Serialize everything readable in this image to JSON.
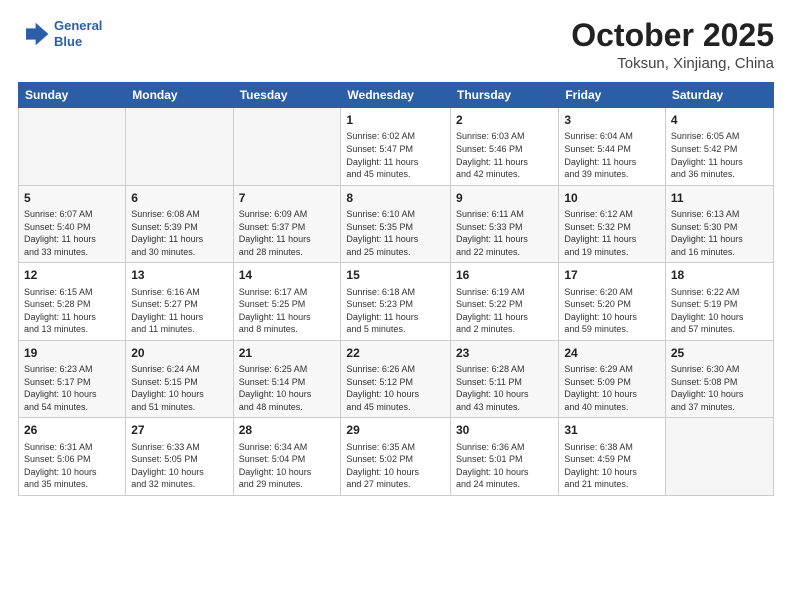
{
  "header": {
    "logo_line1": "General",
    "logo_line2": "Blue",
    "month": "October 2025",
    "location": "Toksun, Xinjiang, China"
  },
  "weekdays": [
    "Sunday",
    "Monday",
    "Tuesday",
    "Wednesday",
    "Thursday",
    "Friday",
    "Saturday"
  ],
  "weeks": [
    [
      {
        "day": "",
        "info": ""
      },
      {
        "day": "",
        "info": ""
      },
      {
        "day": "",
        "info": ""
      },
      {
        "day": "1",
        "info": "Sunrise: 6:02 AM\nSunset: 5:47 PM\nDaylight: 11 hours\nand 45 minutes."
      },
      {
        "day": "2",
        "info": "Sunrise: 6:03 AM\nSunset: 5:46 PM\nDaylight: 11 hours\nand 42 minutes."
      },
      {
        "day": "3",
        "info": "Sunrise: 6:04 AM\nSunset: 5:44 PM\nDaylight: 11 hours\nand 39 minutes."
      },
      {
        "day": "4",
        "info": "Sunrise: 6:05 AM\nSunset: 5:42 PM\nDaylight: 11 hours\nand 36 minutes."
      }
    ],
    [
      {
        "day": "5",
        "info": "Sunrise: 6:07 AM\nSunset: 5:40 PM\nDaylight: 11 hours\nand 33 minutes."
      },
      {
        "day": "6",
        "info": "Sunrise: 6:08 AM\nSunset: 5:39 PM\nDaylight: 11 hours\nand 30 minutes."
      },
      {
        "day": "7",
        "info": "Sunrise: 6:09 AM\nSunset: 5:37 PM\nDaylight: 11 hours\nand 28 minutes."
      },
      {
        "day": "8",
        "info": "Sunrise: 6:10 AM\nSunset: 5:35 PM\nDaylight: 11 hours\nand 25 minutes."
      },
      {
        "day": "9",
        "info": "Sunrise: 6:11 AM\nSunset: 5:33 PM\nDaylight: 11 hours\nand 22 minutes."
      },
      {
        "day": "10",
        "info": "Sunrise: 6:12 AM\nSunset: 5:32 PM\nDaylight: 11 hours\nand 19 minutes."
      },
      {
        "day": "11",
        "info": "Sunrise: 6:13 AM\nSunset: 5:30 PM\nDaylight: 11 hours\nand 16 minutes."
      }
    ],
    [
      {
        "day": "12",
        "info": "Sunrise: 6:15 AM\nSunset: 5:28 PM\nDaylight: 11 hours\nand 13 minutes."
      },
      {
        "day": "13",
        "info": "Sunrise: 6:16 AM\nSunset: 5:27 PM\nDaylight: 11 hours\nand 11 minutes."
      },
      {
        "day": "14",
        "info": "Sunrise: 6:17 AM\nSunset: 5:25 PM\nDaylight: 11 hours\nand 8 minutes."
      },
      {
        "day": "15",
        "info": "Sunrise: 6:18 AM\nSunset: 5:23 PM\nDaylight: 11 hours\nand 5 minutes."
      },
      {
        "day": "16",
        "info": "Sunrise: 6:19 AM\nSunset: 5:22 PM\nDaylight: 11 hours\nand 2 minutes."
      },
      {
        "day": "17",
        "info": "Sunrise: 6:20 AM\nSunset: 5:20 PM\nDaylight: 10 hours\nand 59 minutes."
      },
      {
        "day": "18",
        "info": "Sunrise: 6:22 AM\nSunset: 5:19 PM\nDaylight: 10 hours\nand 57 minutes."
      }
    ],
    [
      {
        "day": "19",
        "info": "Sunrise: 6:23 AM\nSunset: 5:17 PM\nDaylight: 10 hours\nand 54 minutes."
      },
      {
        "day": "20",
        "info": "Sunrise: 6:24 AM\nSunset: 5:15 PM\nDaylight: 10 hours\nand 51 minutes."
      },
      {
        "day": "21",
        "info": "Sunrise: 6:25 AM\nSunset: 5:14 PM\nDaylight: 10 hours\nand 48 minutes."
      },
      {
        "day": "22",
        "info": "Sunrise: 6:26 AM\nSunset: 5:12 PM\nDaylight: 10 hours\nand 45 minutes."
      },
      {
        "day": "23",
        "info": "Sunrise: 6:28 AM\nSunset: 5:11 PM\nDaylight: 10 hours\nand 43 minutes."
      },
      {
        "day": "24",
        "info": "Sunrise: 6:29 AM\nSunset: 5:09 PM\nDaylight: 10 hours\nand 40 minutes."
      },
      {
        "day": "25",
        "info": "Sunrise: 6:30 AM\nSunset: 5:08 PM\nDaylight: 10 hours\nand 37 minutes."
      }
    ],
    [
      {
        "day": "26",
        "info": "Sunrise: 6:31 AM\nSunset: 5:06 PM\nDaylight: 10 hours\nand 35 minutes."
      },
      {
        "day": "27",
        "info": "Sunrise: 6:33 AM\nSunset: 5:05 PM\nDaylight: 10 hours\nand 32 minutes."
      },
      {
        "day": "28",
        "info": "Sunrise: 6:34 AM\nSunset: 5:04 PM\nDaylight: 10 hours\nand 29 minutes."
      },
      {
        "day": "29",
        "info": "Sunrise: 6:35 AM\nSunset: 5:02 PM\nDaylight: 10 hours\nand 27 minutes."
      },
      {
        "day": "30",
        "info": "Sunrise: 6:36 AM\nSunset: 5:01 PM\nDaylight: 10 hours\nand 24 minutes."
      },
      {
        "day": "31",
        "info": "Sunrise: 6:38 AM\nSunset: 4:59 PM\nDaylight: 10 hours\nand 21 minutes."
      },
      {
        "day": "",
        "info": ""
      }
    ]
  ]
}
